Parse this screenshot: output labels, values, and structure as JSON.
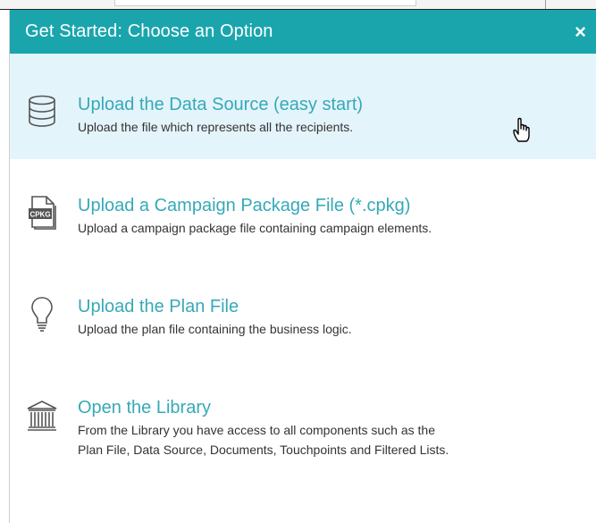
{
  "dialog": {
    "title": "Get Started: Choose an Option",
    "close_label": "×"
  },
  "options": [
    {
      "title": "Upload the Data Source (easy start)",
      "description": "Upload the file which represents all the recipients.",
      "icon": "database-icon",
      "hovered": true
    },
    {
      "title": "Upload a Campaign Package File (*.cpkg)",
      "description": "Upload a campaign package file containing campaign elements.",
      "icon": "cpkg-file-icon",
      "icon_text": "CPKG"
    },
    {
      "title": "Upload the Plan File",
      "description": "Upload the plan file containing the business logic.",
      "icon": "lightbulb-icon"
    },
    {
      "title": "Open the Library",
      "description_lines": [
        "From the Library you have access to all components such as the",
        "Plan File, Data Source, Documents, Touchpoints and Filtered Lists."
      ],
      "icon": "library-icon"
    }
  ],
  "colors": {
    "header": "#1aa5ad",
    "link": "#36a9b7",
    "hover": "#e4f4fb",
    "icon": "#555555"
  }
}
